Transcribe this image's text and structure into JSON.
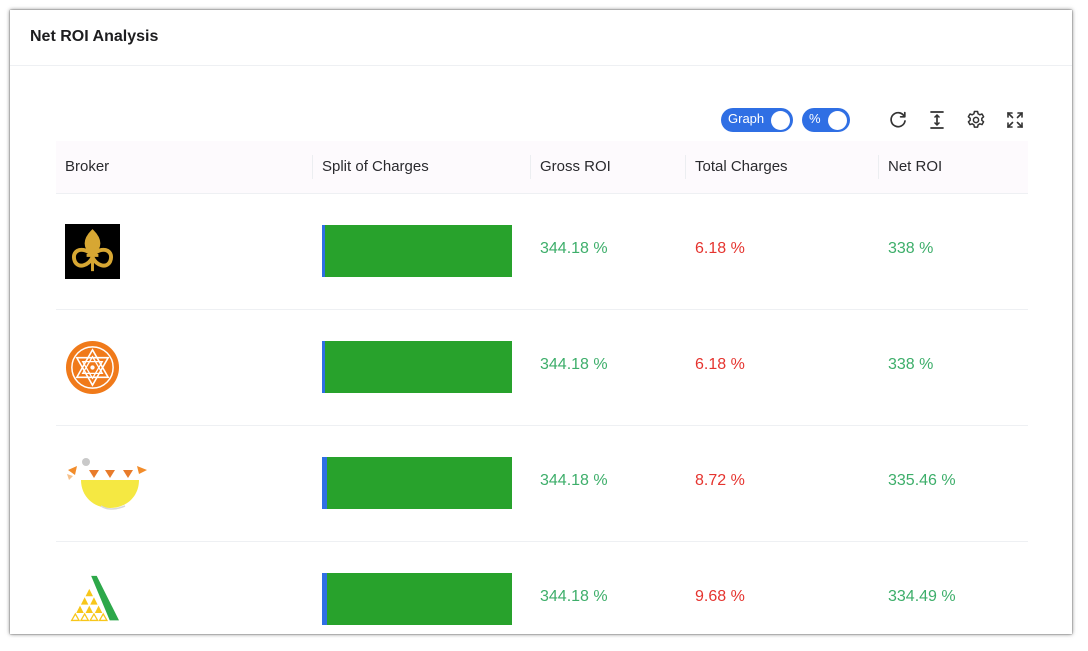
{
  "card": {
    "title": "Net ROI Analysis"
  },
  "toolbar": {
    "graph_toggle_label": "Graph",
    "percent_toggle_label": "%",
    "refresh_icon": "refresh-icon",
    "height_icon": "text-height-icon",
    "settings_icon": "gear-icon",
    "fullscreen_icon": "expand-icon"
  },
  "colors": {
    "accent": "#2f6fe4",
    "bar_green": "#28a22c",
    "positive": "#3dae6a",
    "negative": "#e5342f"
  },
  "table": {
    "columns": [
      "Broker",
      "Split of Charges",
      "Gross ROI",
      "Total Charges",
      "Net ROI"
    ],
    "rows": [
      {
        "logo": "fleur-de-lis-logo",
        "gross": "344.18 %",
        "charges": "6.18 %",
        "net": "338 %",
        "charges_fraction": 0.018
      },
      {
        "logo": "sri-yantra-logo",
        "gross": "344.18 %",
        "charges": "6.18 %",
        "net": "338 %",
        "charges_fraction": 0.018
      },
      {
        "logo": "bowl-logo",
        "gross": "344.18 %",
        "charges": "8.72 %",
        "net": "335.46 %",
        "charges_fraction": 0.025
      },
      {
        "logo": "triangle-logo",
        "gross": "344.18 %",
        "charges": "9.68 %",
        "net": "334.49 %",
        "charges_fraction": 0.028
      }
    ]
  }
}
